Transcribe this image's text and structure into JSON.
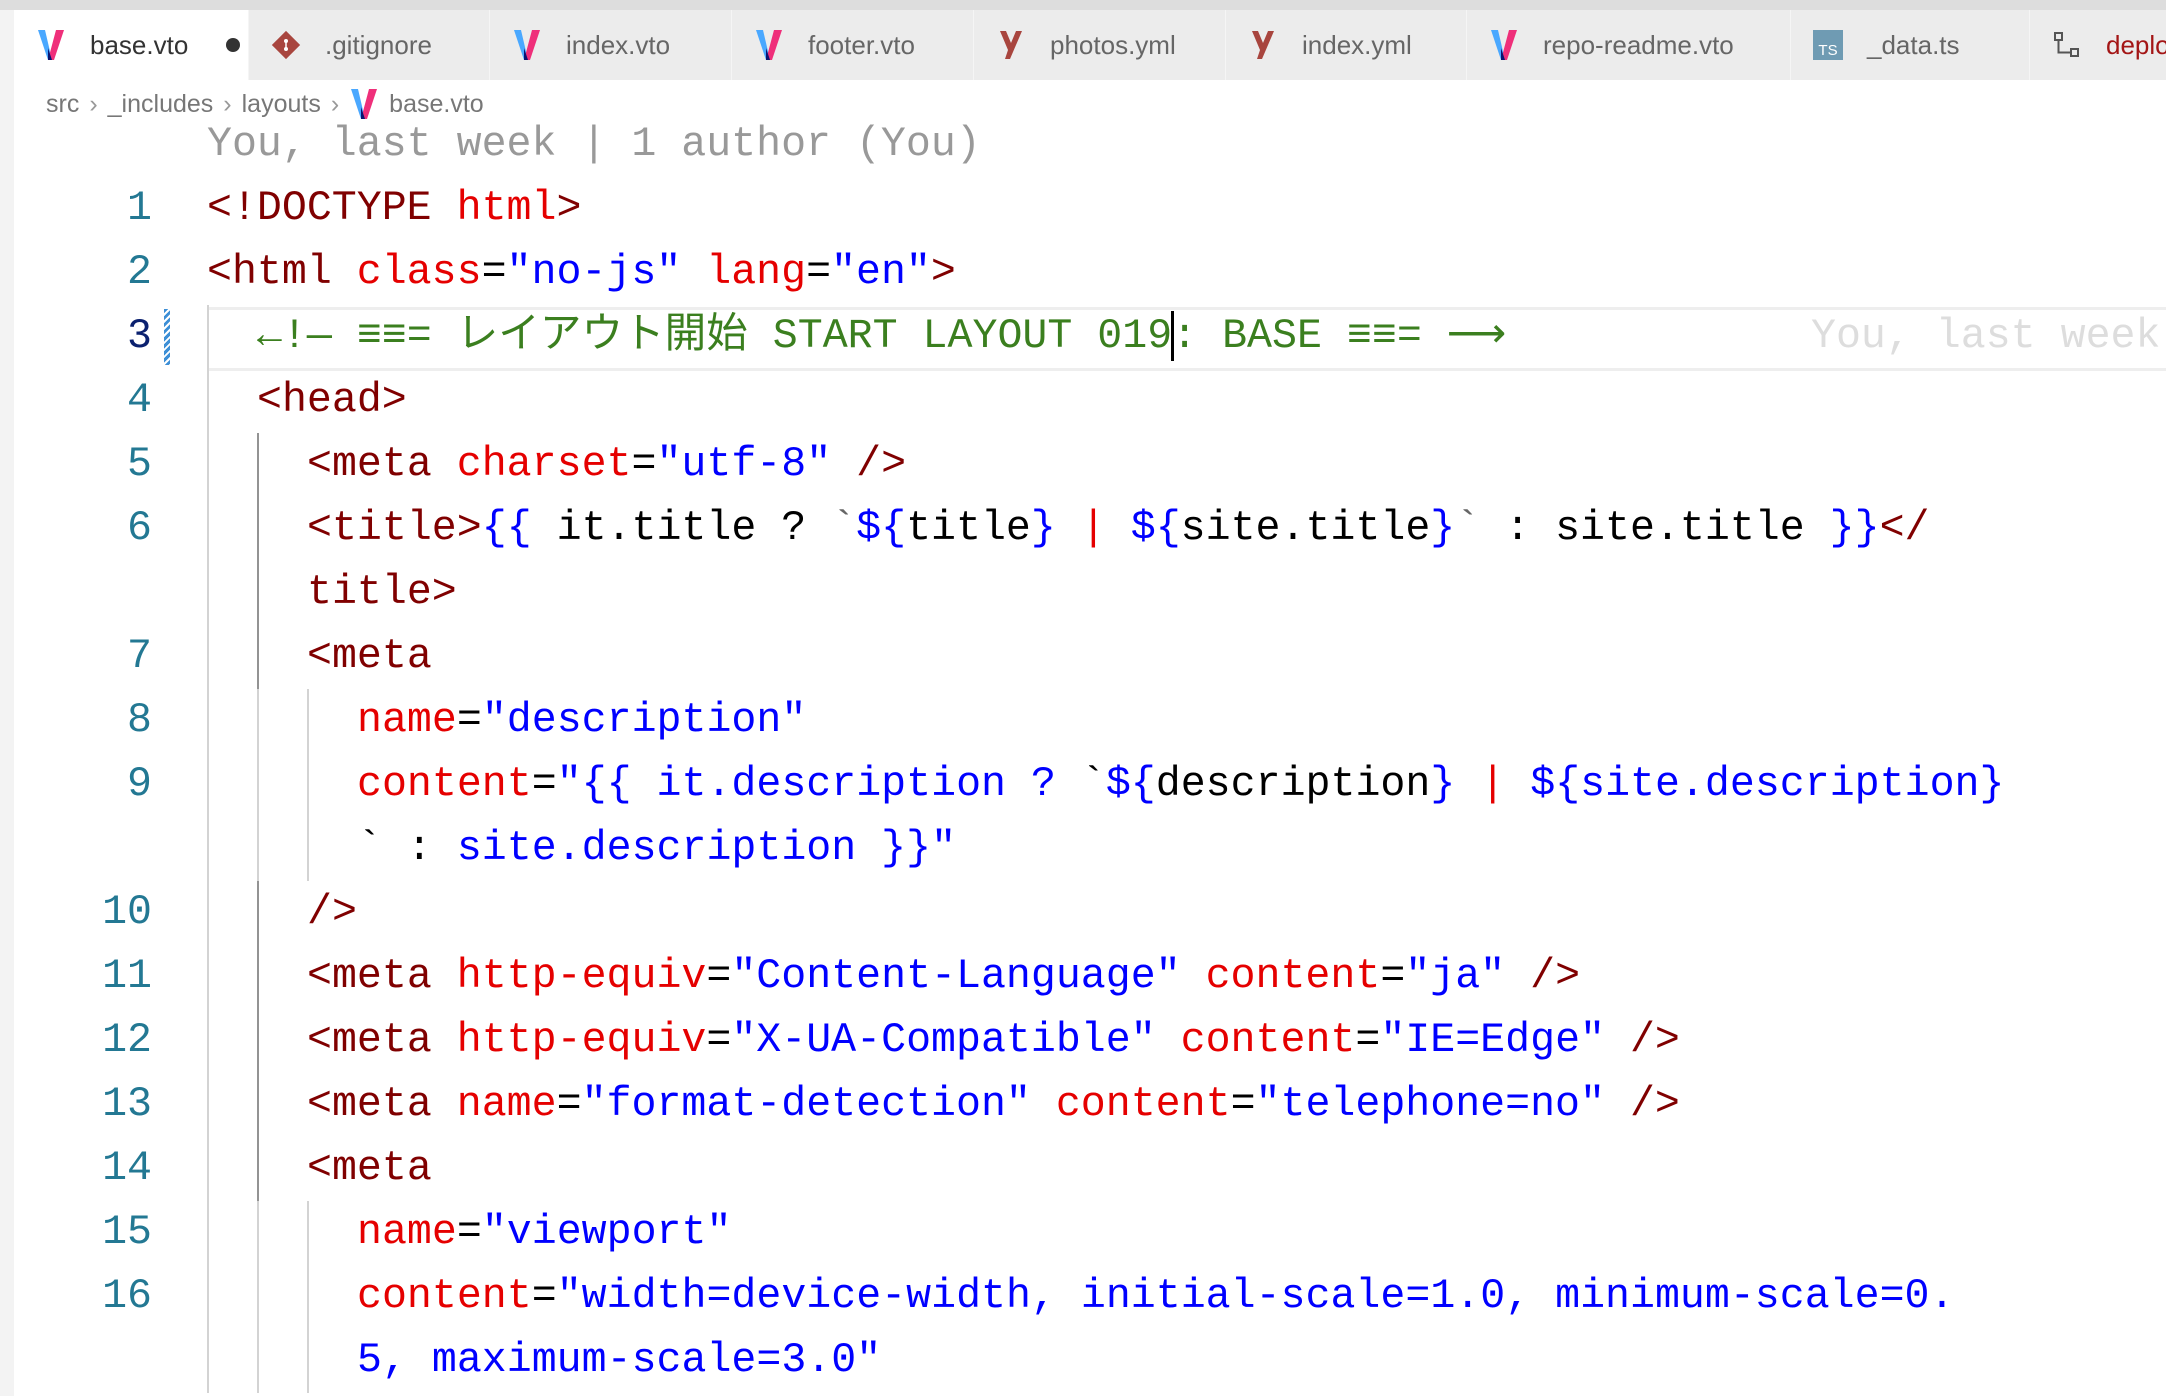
{
  "tabs": [
    {
      "label": "base.vto",
      "icon": "vento-icon",
      "active": true,
      "modified": true,
      "width": 235
    },
    {
      "label": ".gitignore",
      "icon": "git-icon",
      "width": 241
    },
    {
      "label": "index.vto",
      "icon": "vento-icon",
      "width": 242
    },
    {
      "label": "footer.vto",
      "icon": "vento-icon",
      "width": 242
    },
    {
      "label": "photos.yml",
      "icon": "yaml-icon",
      "width": 252
    },
    {
      "label": "index.yml",
      "icon": "yaml-icon",
      "width": 241
    },
    {
      "label": "repo-readme.vto",
      "icon": "vento-icon",
      "width": 324
    },
    {
      "label": "_data.ts",
      "icon": "typescript-icon",
      "width": 239
    },
    {
      "label": "deplo",
      "icon": "workflow-icon",
      "width": 140,
      "labelColor": "#a31515"
    }
  ],
  "breadcrumb": [
    "src",
    "_includes",
    "layouts",
    "base.vto"
  ],
  "blame_header": "You, last week | 1 author (You)",
  "inline_blame": "You, last week",
  "colors": {
    "tag": "#800000",
    "attribute": "#e50000",
    "string": "#0000ff",
    "comment": "#3b7f1f",
    "line_number": "#237893"
  },
  "lines": [
    {
      "n": "1",
      "indent": 0,
      "tokens": [
        [
          "t",
          "<!DOCTYPE "
        ],
        [
          "a",
          "html"
        ],
        [
          "t",
          ">"
        ]
      ]
    },
    {
      "n": "2",
      "indent": 0,
      "tokens": [
        [
          "t",
          "<html "
        ],
        [
          "a",
          "class"
        ],
        [
          "p",
          "="
        ],
        [
          "s",
          "\"no-js\" "
        ],
        [
          "a",
          "lang"
        ],
        [
          "p",
          "="
        ],
        [
          "s",
          "\"en\""
        ],
        [
          "t",
          ">"
        ]
      ]
    },
    {
      "n": "3",
      "indent": 1,
      "current": true,
      "tokens": [
        [
          "c",
          "←!— ≡≡= レイアウト開始 START LAYOUT 019"
        ],
        [
          "cursor",
          ""
        ],
        [
          "c",
          ": BASE ≡≡= ⟶"
        ]
      ]
    },
    {
      "n": "4",
      "indent": 1,
      "tokens": [
        [
          "t",
          "<head>"
        ]
      ]
    },
    {
      "n": "5",
      "indent": 2,
      "tokens": [
        [
          "t",
          "<meta "
        ],
        [
          "a",
          "charset"
        ],
        [
          "p",
          "="
        ],
        [
          "s",
          "\"utf-8\" "
        ],
        [
          "t",
          "/>"
        ]
      ]
    },
    {
      "n": "6",
      "indent": 2,
      "tokens": [
        [
          "t",
          "<title>"
        ],
        [
          "b",
          "{{"
        ],
        [
          "x",
          " it.title ? "
        ],
        [
          "bt",
          "`"
        ],
        [
          "b",
          "${"
        ],
        [
          "x",
          "title"
        ],
        [
          "b",
          "}"
        ],
        [
          "a",
          " | "
        ],
        [
          "b",
          "${"
        ],
        [
          "x",
          "site.title"
        ],
        [
          "b",
          "}"
        ],
        [
          "bt",
          "`"
        ],
        [
          "x",
          " : site.title "
        ],
        [
          "b",
          "}}"
        ],
        [
          "t",
          "</"
        ]
      ]
    },
    {
      "n": "",
      "indent": 2,
      "tokens": [
        [
          "t",
          "title>"
        ]
      ]
    },
    {
      "n": "7",
      "indent": 2,
      "tokens": [
        [
          "t",
          "<meta"
        ]
      ]
    },
    {
      "n": "8",
      "indent": 3,
      "tokens": [
        [
          "a",
          "name"
        ],
        [
          "p",
          "="
        ],
        [
          "s",
          "\"description\""
        ]
      ]
    },
    {
      "n": "9",
      "indent": 3,
      "tokens": [
        [
          "a",
          "content"
        ],
        [
          "p",
          "="
        ],
        [
          "s",
          "\"{{ it.description ? "
        ],
        [
          "x",
          "`"
        ],
        [
          "b",
          "${"
        ],
        [
          "x",
          "description"
        ],
        [
          "b",
          "}"
        ],
        [
          "a",
          " | "
        ],
        [
          "s",
          "${site.description}"
        ]
      ]
    },
    {
      "n": "",
      "indent": 3,
      "tokens": [
        [
          "x",
          "` : "
        ],
        [
          "s",
          "site.description }}\""
        ]
      ]
    },
    {
      "n": "10",
      "indent": 2,
      "tokens": [
        [
          "t",
          "/>"
        ]
      ]
    },
    {
      "n": "11",
      "indent": 2,
      "tokens": [
        [
          "t",
          "<meta "
        ],
        [
          "a",
          "http-equiv"
        ],
        [
          "p",
          "="
        ],
        [
          "s",
          "\"Content-Language\" "
        ],
        [
          "a",
          "content"
        ],
        [
          "p",
          "="
        ],
        [
          "s",
          "\"ja\" "
        ],
        [
          "t",
          "/>"
        ]
      ]
    },
    {
      "n": "12",
      "indent": 2,
      "tokens": [
        [
          "t",
          "<meta "
        ],
        [
          "a",
          "http-equiv"
        ],
        [
          "p",
          "="
        ],
        [
          "s",
          "\"X-UA-Compatible\" "
        ],
        [
          "a",
          "content"
        ],
        [
          "p",
          "="
        ],
        [
          "s",
          "\"IE=Edge\" "
        ],
        [
          "t",
          "/>"
        ]
      ]
    },
    {
      "n": "13",
      "indent": 2,
      "tokens": [
        [
          "t",
          "<meta "
        ],
        [
          "a",
          "name"
        ],
        [
          "p",
          "="
        ],
        [
          "s",
          "\"format-detection\" "
        ],
        [
          "a",
          "content"
        ],
        [
          "p",
          "="
        ],
        [
          "s",
          "\"telephone=no\" "
        ],
        [
          "t",
          "/>"
        ]
      ]
    },
    {
      "n": "14",
      "indent": 2,
      "tokens": [
        [
          "t",
          "<meta"
        ]
      ]
    },
    {
      "n": "15",
      "indent": 3,
      "tokens": [
        [
          "a",
          "name"
        ],
        [
          "p",
          "="
        ],
        [
          "s",
          "\"viewport\""
        ]
      ]
    },
    {
      "n": "16",
      "indent": 3,
      "tokens": [
        [
          "a",
          "content"
        ],
        [
          "p",
          "="
        ],
        [
          "s",
          "\"width=device-width, initial-scale=1.0, minimum-scale=0."
        ]
      ]
    },
    {
      "n": "",
      "indent": 3,
      "tokens": [
        [
          "s",
          "5, maximum-scale=3.0\""
        ]
      ]
    }
  ]
}
